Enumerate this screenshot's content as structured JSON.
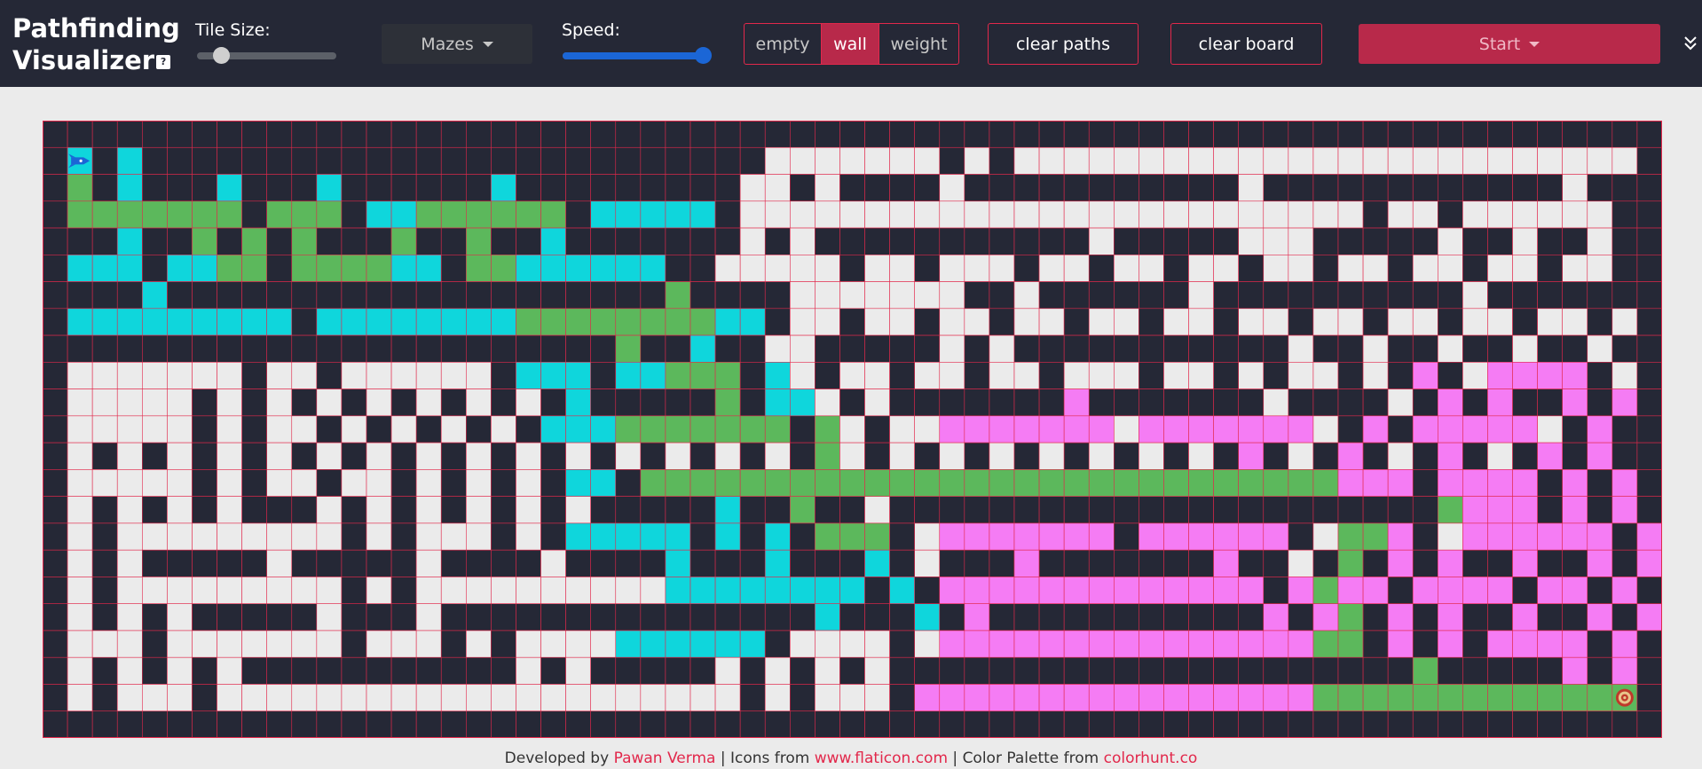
{
  "app": {
    "title_line1": "Pathfinding",
    "title_line2": "Visualizer",
    "help_badge": "?"
  },
  "controls": {
    "tile_size_label": "Tile Size:",
    "tile_size_value": 0.17,
    "mazes_label": "Mazes",
    "speed_label": "Speed:",
    "speed_value": 1.0,
    "toggle_options": [
      "empty",
      "wall",
      "weight"
    ],
    "toggle_selected": "wall",
    "clear_paths_label": "clear paths",
    "clear_board_label": "clear board",
    "start_label": "Start"
  },
  "icons": {
    "help": "help-icon",
    "mazes_caret": "chevron-down-icon",
    "start_caret": "chevron-down-icon",
    "collapse": "double-chevron-down-icon",
    "start_node": "rocket-icon",
    "end_node": "target-icon"
  },
  "colors": {
    "navbar": "#252836",
    "accent": "#e2284b",
    "start_button": "#b8294a",
    "wall": "#252836",
    "empty": "#ebebeb",
    "visited_start": "#0fd6dc",
    "visited_end": "#f57cf4",
    "path": "#5cb85c",
    "grid_line": "#e2284b",
    "speed_slider": "#1b66d6"
  },
  "grid": {
    "legend": {
      "#": "wall",
      ".": "empty",
      "c": "visited-from-start",
      "m": "visited-from-end",
      "g": "shortest-path",
      "S": "start-node",
      "E": "end-node"
    },
    "rows": [
      "#################################################################",
      "#S#c#wwwww#wwwwwww#wwwwwwwww#.......#.#.........................#",
      "#g#c###c###c######c#########..#.####.###########.############.###",
      "#ggggggg#ggg#ccgggggg#ccccc#.........................#..#......#",
      "###c##g#g#g###g##g##c#######.#.###########.#####...#####.##.##.#",
      "#ccc#ccgg#ggggcc#ggcccccc##.....#..#...#..#..#..#..#..#..#..#..#",
      "####c####################g####.......##.######.##########.######",
      "#ccccccccc#ccccccccggggggggcc#..#..#..#..#..#..#..#..#..#..#..#.",
      "#######################g##c##..#####.#.###########.##.##.##.##.#",
      "#.......#..#......#ccc#ccggg#c.#..#..#..#...#..#.#..#.#m#.mmmm#.",
      "#.....#.#.#.#.#.#.#.#c#####g#cc.#.#######m#######.####.#m#m##m#m",
      "#.....#.#..#.#.#.#.#cccggggggg#g.#..mmmmmmm.mmmmmmm.#m#mmmmm.#m",
      "#.#.#.#.#.#.#.#.#.#.#.#.#.#.#.#g.#.#.#.#.#.#.#.#m#.#m#.#m#.#m#m",
      "#.....#.#..#..#.#.#.#cc#ggggggggggggggggggggggggggggmmm#mmmm#m#m",
      "#.#.#.#.###.#.#.#.#.#.#####c##g##.######################gmmm#m#m",
      "#.#.........#.#...#.#ccccc#c#c#ggg#.mmmmmmm#mmmmmm#.ggm#.mmmmmm#m",
      "#.#.#####.#####.####.####c###c###c#.###m#######m##.#g#m#m##m##m#m",
      "#.#.........#.#..........cccccccc#c#mmmmmmmmmmmmm#mgmm#mmmm#mm#m",
      "#.#.#.#####.###.###############c###c#m###########m#mg#m#m##m##m#m",
      "#...#.......#...#.#....cccccc#....#.mmmmmmmmmmmmmmmgg#m#m#mmmm#m",
      "#.#.#.#.###########.#.#####.#.#.#.#####################g#####m#m",
      "#.#...#.....................#.#...#mmmmmmmmmmmmmmmmggggggggggggE#",
      "#################################################################"
    ]
  },
  "footer": {
    "prefix": "Developed by ",
    "author": "Pawan Verma",
    "mid1": " | Icons from ",
    "icons_site": "www.flaticon.com",
    "mid2": " | Color Palette from ",
    "palette_site": "colorhunt.co"
  }
}
